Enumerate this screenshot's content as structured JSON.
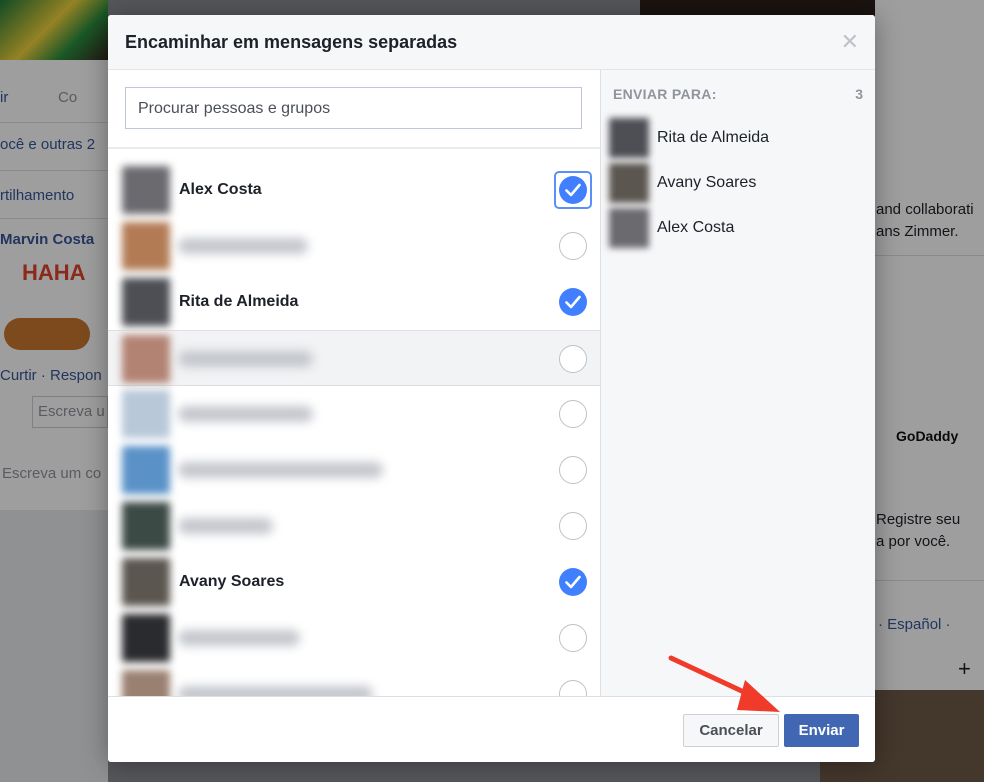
{
  "background": {
    "left_texts": [
      "ir",
      "Co",
      "ocê e outras 2",
      "rtilhamento",
      "Marvin Costa",
      "Curtir · Respon",
      "Escreva u",
      "Escreva um co"
    ],
    "right_texts": [
      "and collaborati",
      "ans Zimmer.",
      "GoDaddy",
      "Registre seu",
      "a por você.",
      "· Español ·",
      "+"
    ],
    "sticker_text": "HAHA"
  },
  "dialog": {
    "title": "Encaminhar em mensagens separadas",
    "close_icon": "close-icon",
    "search": {
      "placeholder": "Procurar pessoas e grupos"
    },
    "contacts": [
      {
        "name": "Alex Costa",
        "selected": true,
        "focused": true,
        "avatar_color": "#6b6a6f"
      },
      {
        "name": "",
        "selected": false,
        "avatar_color": "#b27b54"
      },
      {
        "name": "Rita de Almeida",
        "selected": true,
        "avatar_color": "#4d4f55"
      },
      {
        "name": "",
        "selected": false,
        "hovered": true,
        "avatar_color": "#b28272"
      },
      {
        "name": "",
        "selected": false,
        "avatar_color": "#b8c8d8"
      },
      {
        "name": "",
        "selected": false,
        "avatar_color": "#5a92c8"
      },
      {
        "name": "",
        "selected": false,
        "avatar_color": "#3c4a46"
      },
      {
        "name": "Avany Soares",
        "selected": true,
        "avatar_color": "#5c5650"
      },
      {
        "name": "",
        "selected": false,
        "avatar_color": "#2a2b2e"
      },
      {
        "name": "",
        "selected": false,
        "avatar_color": "#9a8070"
      }
    ],
    "send_to_label": "ENVIAR PARA:",
    "send_to_count": "3",
    "recipients": [
      {
        "name": "Rita de Almeida",
        "avatar_color": "#4d4f55"
      },
      {
        "name": "Avany Soares",
        "avatar_color": "#5c5650"
      },
      {
        "name": "Alex Costa",
        "avatar_color": "#6b6a6f"
      }
    ],
    "cancel_label": "Cancelar",
    "send_label": "Enviar"
  },
  "colors": {
    "accent": "#4267b2",
    "check": "#4080ff",
    "annotation_arrow": "#f03a2a"
  }
}
